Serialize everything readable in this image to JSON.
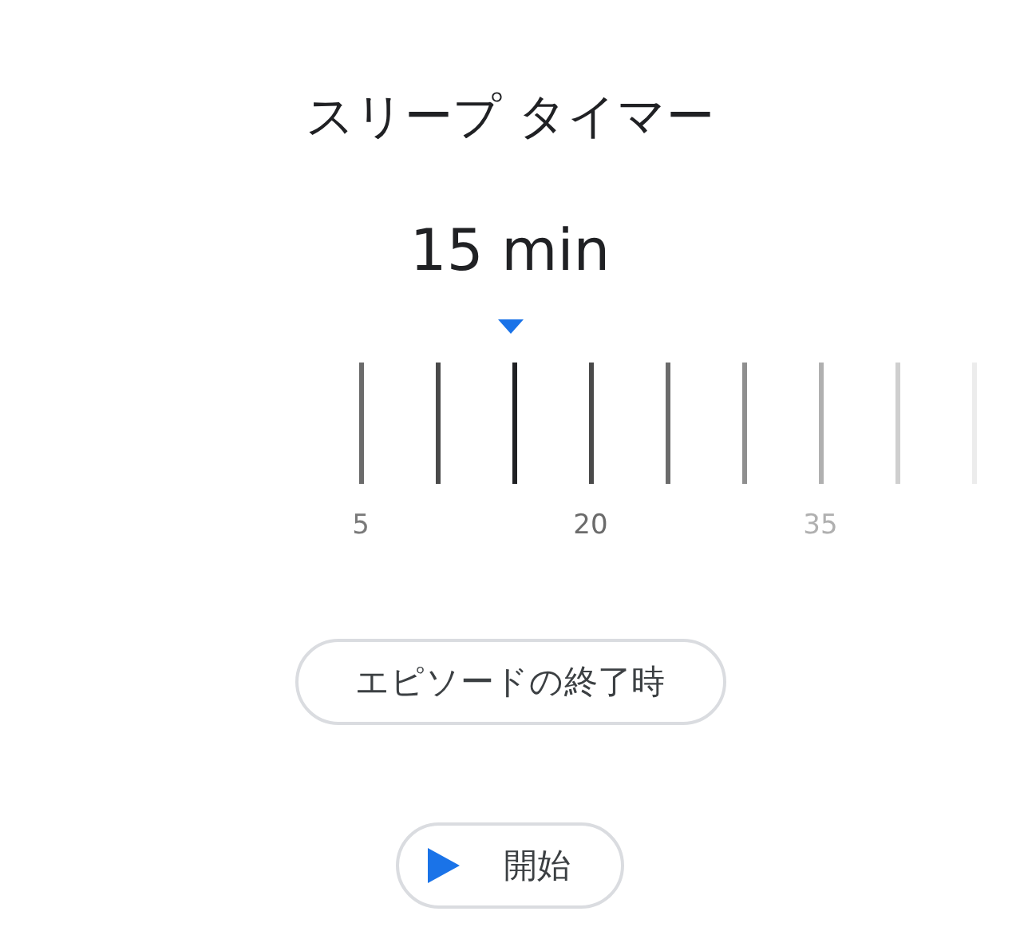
{
  "title": "スリープ タイマー",
  "value": "15 min",
  "ticks": [
    {
      "label": "5",
      "selected": false
    },
    {
      "selected": false
    },
    {
      "selected": true
    },
    {
      "label": "20",
      "selected": false
    },
    {
      "selected": false
    },
    {
      "selected": false
    },
    {
      "label": "35",
      "selected": false
    },
    {
      "selected": false
    },
    {
      "selected": false
    }
  ],
  "episode_button": "エピソードの終了時",
  "start_button": "開始"
}
